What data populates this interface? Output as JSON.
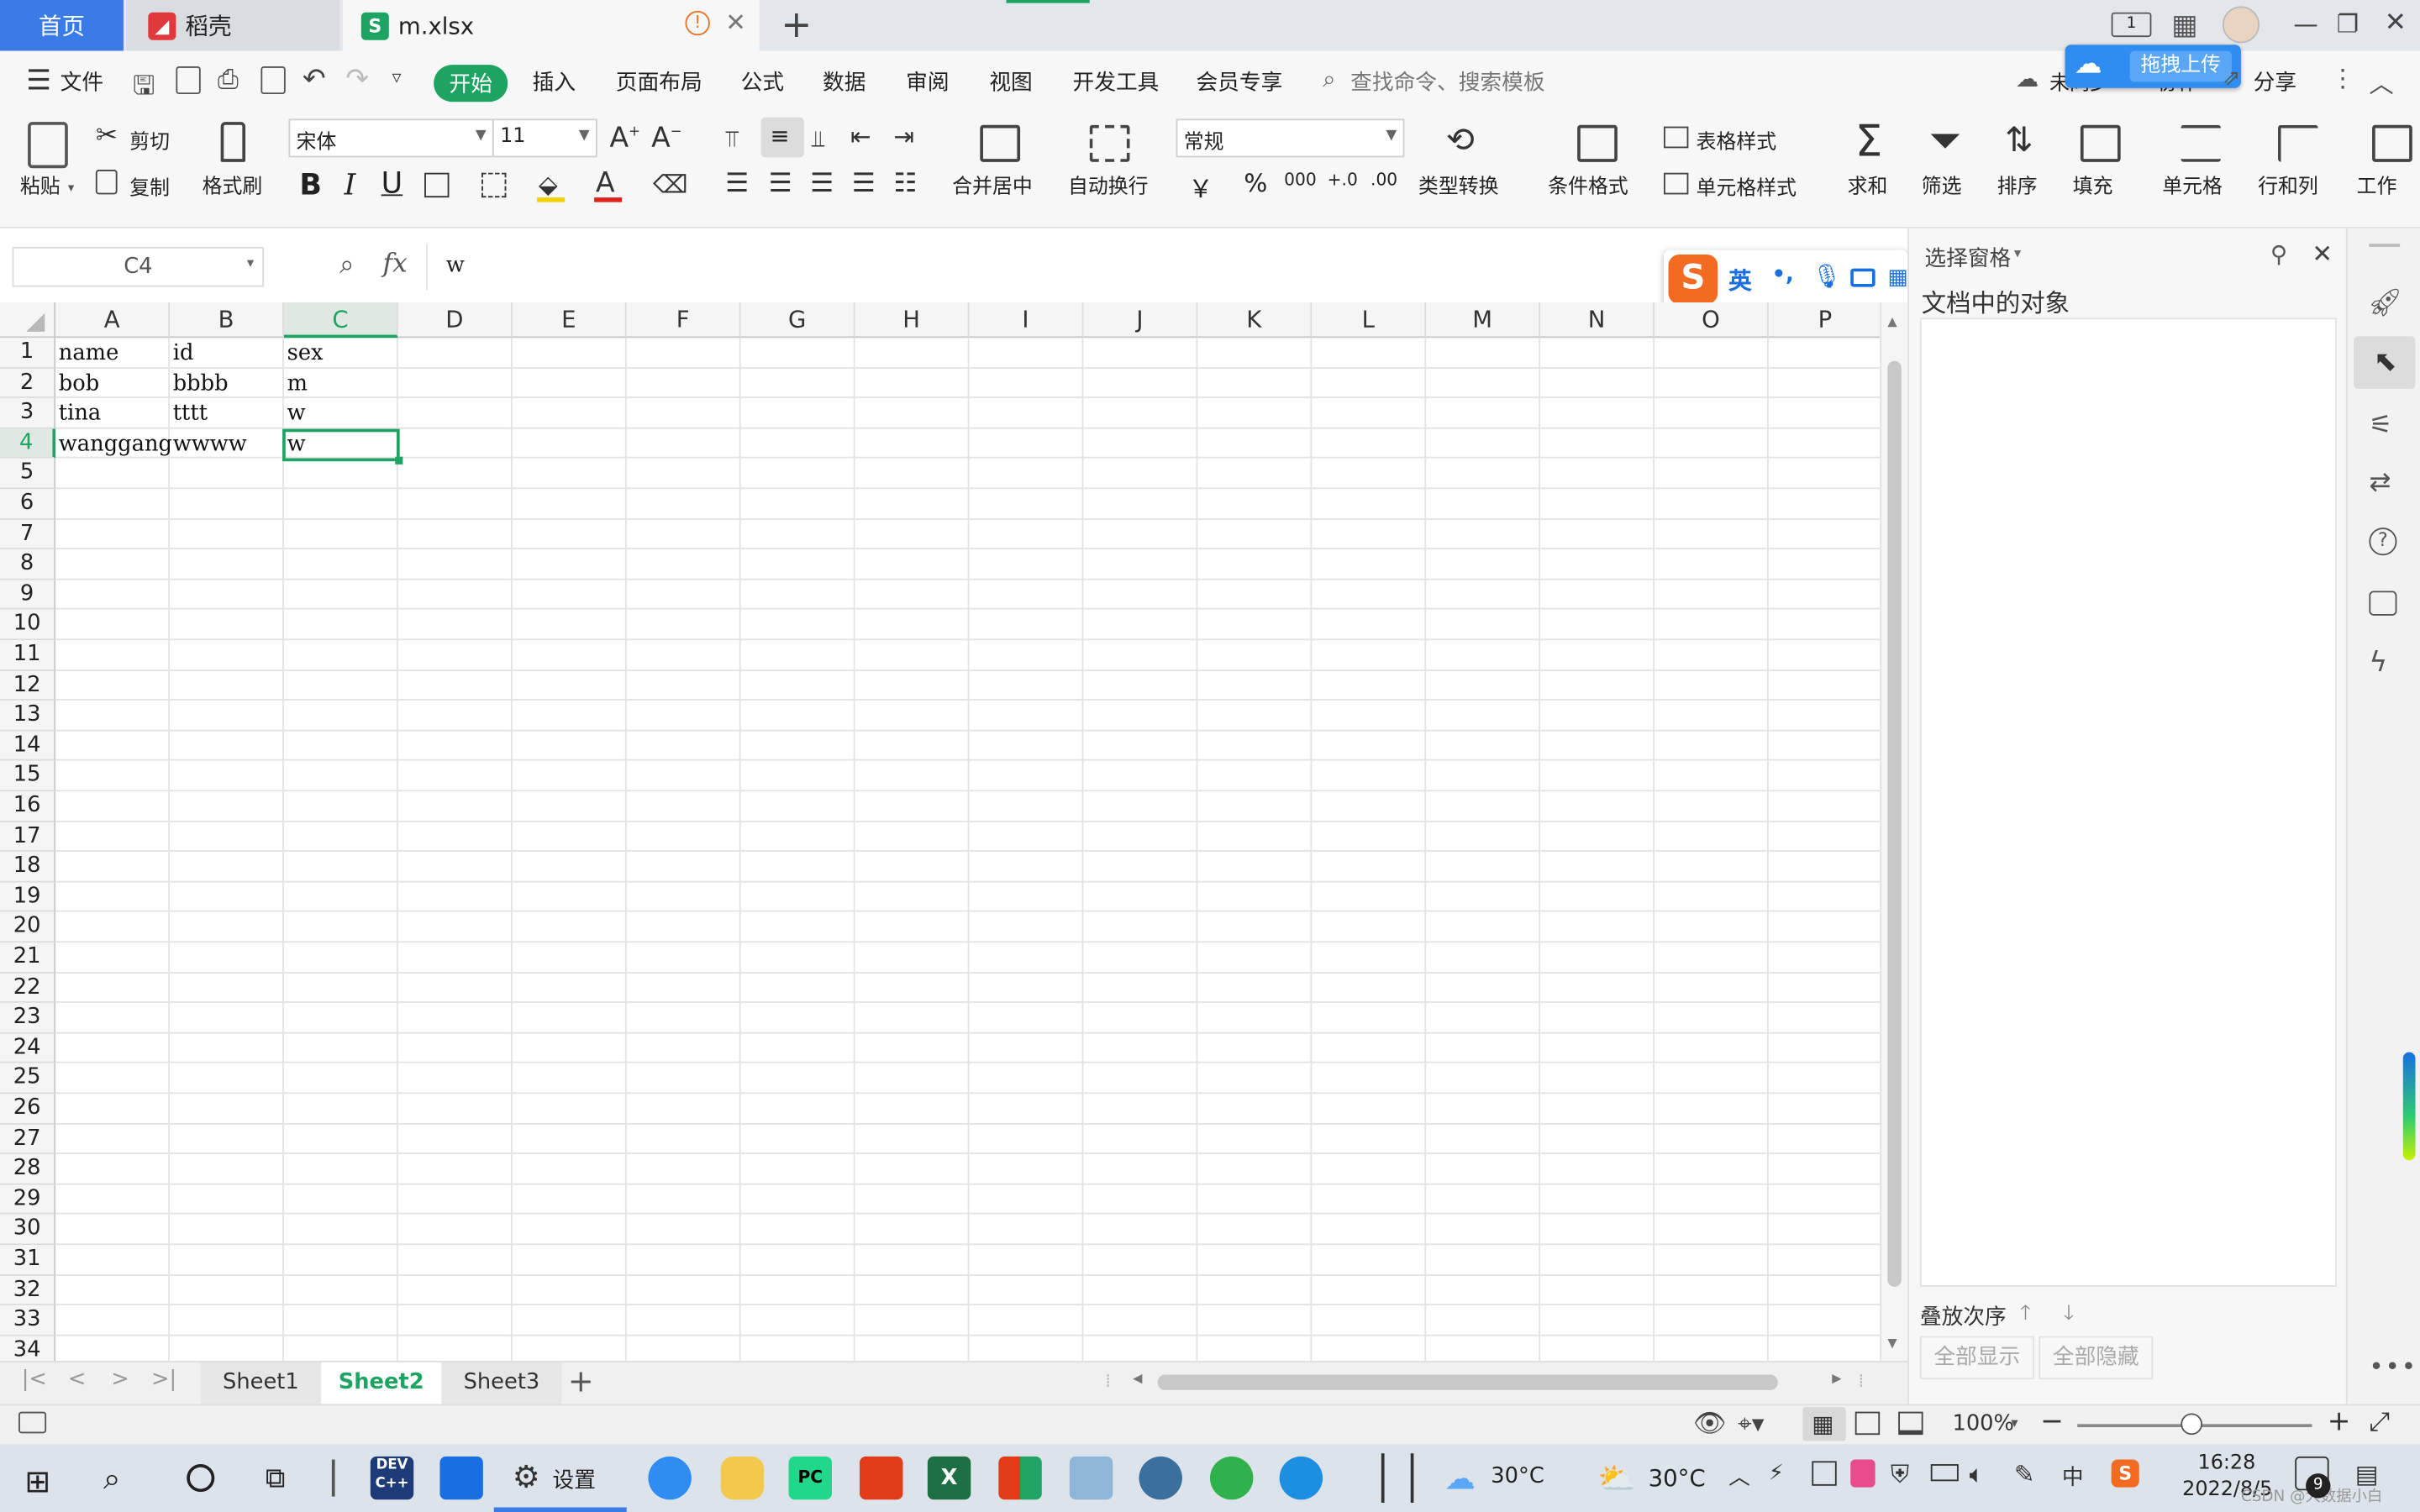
{
  "tabs": {
    "home": "首页",
    "docer": "稻壳",
    "file": "m.xlsx"
  },
  "menu": {
    "file": "文件",
    "items": [
      "开始",
      "插入",
      "页面布局",
      "公式",
      "数据",
      "审阅",
      "视图",
      "开发工具",
      "会员专享"
    ],
    "search_placeholder": "查找命令、搜索模板",
    "sync": "未同步",
    "collab": "协作",
    "share": "分享",
    "upload_badge": "拖拽上传"
  },
  "ribbon": {
    "paste": "粘贴",
    "cut": "剪切",
    "copy": "复制",
    "format_painter": "格式刷",
    "font_name": "宋体",
    "font_size": "11",
    "merge_center": "合并居中",
    "wrap_text": "自动换行",
    "number_format": "常规",
    "type_convert": "类型转换",
    "cond_format": "条件格式",
    "table_style": "表格样式",
    "cell_style": "单元格样式",
    "sum": "求和",
    "filter": "筛选",
    "sort": "排序",
    "fill": "填充",
    "cell": "单元格",
    "rows_cols": "行和列",
    "worksheet": "工作",
    "currency": "￥",
    "percent": "%",
    "thousands": "000",
    "inc_dec": "+.0",
    "dec_dec": ".00"
  },
  "formula": {
    "name_box": "C4",
    "fx": "fx",
    "value": "w"
  },
  "ime": {
    "lang": "英",
    "punct": "•,"
  },
  "columns": [
    "A",
    "B",
    "C",
    "D",
    "E",
    "F",
    "G",
    "H",
    "I",
    "J",
    "K",
    "L",
    "M",
    "N",
    "O",
    "P"
  ],
  "rows": [
    "1",
    "2",
    "3",
    "4",
    "5",
    "6",
    "7",
    "8",
    "9",
    "10",
    "11",
    "12",
    "13",
    "14",
    "15",
    "16",
    "17",
    "18",
    "19",
    "20",
    "21",
    "22",
    "23",
    "24",
    "25",
    "26",
    "27",
    "28",
    "29",
    "30",
    "31",
    "32",
    "33",
    "34"
  ],
  "cells": [
    [
      "name",
      "id",
      "sex"
    ],
    [
      "bob",
      "bbbb",
      "m"
    ],
    [
      "tina",
      "tttt",
      "w"
    ],
    [
      "wanggang",
      "wwww",
      "w"
    ]
  ],
  "right_panel": {
    "title": "选择窗格",
    "objects_label": "文档中的对象",
    "order_label": "叠放次序",
    "show_all": "全部显示",
    "hide_all": "全部隐藏"
  },
  "sheets": [
    "Sheet1",
    "Sheet2",
    "Sheet3"
  ],
  "active_sheet": "Sheet2",
  "status": {
    "zoom": "100%"
  },
  "taskbar": {
    "settings": "设置",
    "weather1": "30°C",
    "weather2": "30°C",
    "time": "16:28",
    "date": "2022/8/5",
    "notifications": "9",
    "watermark": "CSDN @大数据小白"
  },
  "colors": {
    "accent_green": "#1ea462",
    "home_tab": "#3b7be8",
    "selection": "#1ea462"
  }
}
